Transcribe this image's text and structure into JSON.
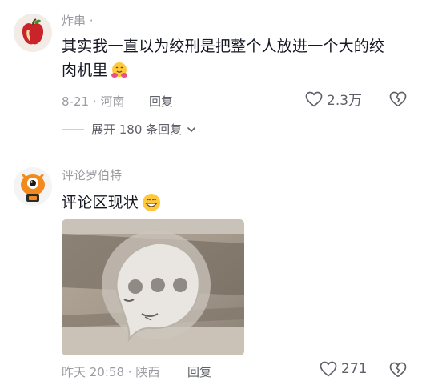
{
  "comments": [
    {
      "username": "炸串",
      "username_dot": "·",
      "content_lines": [
        "其实我一直以为绞刑是把整个人放进一个大的绞",
        "肉机里"
      ],
      "emoji_icon": "hugging-face-icon",
      "date": "8-21",
      "location": "河南",
      "reply_label": "回复",
      "like_count": "2.3万",
      "expand_label": "展开 180 条回复"
    },
    {
      "username": "评论罗伯特",
      "content": "评论区现状",
      "emoji_icon": "grinning-face-icon",
      "image_icon": "meme-speech-bubble-face-image",
      "date": "昨天 20:58",
      "location": "陕西",
      "reply_label": "回复",
      "like_count": "271"
    }
  ],
  "colors": {
    "text": "#161823",
    "meta": "#9b9ca1",
    "action": "#5f6168"
  }
}
